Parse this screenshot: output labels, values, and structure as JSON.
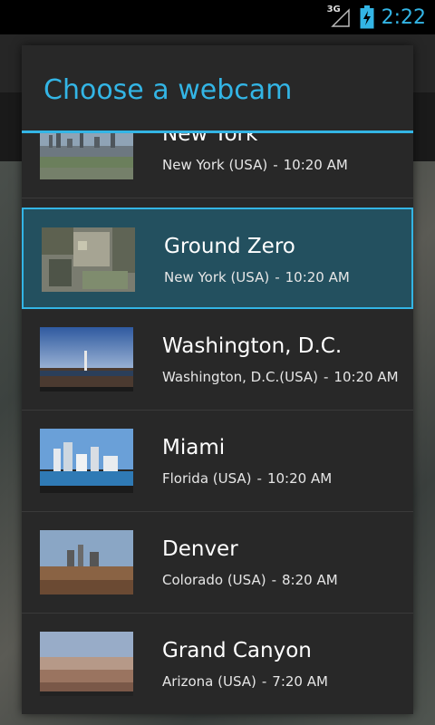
{
  "status": {
    "network": "3G",
    "time": "2:22"
  },
  "dialog": {
    "title": "Choose a webcam"
  },
  "webcams": [
    {
      "name": "New York",
      "location": "New York (USA)",
      "local_time": "10:20 AM"
    },
    {
      "name": "Ground Zero",
      "location": "New York (USA)",
      "local_time": "10:20 AM",
      "selected": true
    },
    {
      "name": "Washington, D.C.",
      "location": "Washington, D.C.(USA)",
      "local_time": "10:20 AM"
    },
    {
      "name": "Miami",
      "location": "Florida (USA)",
      "local_time": "10:20 AM"
    },
    {
      "name": "Denver",
      "location": "Colorado (USA)",
      "local_time": "8:20 AM"
    },
    {
      "name": "Grand Canyon",
      "location": "Arizona (USA)",
      "local_time": "7:20 AM"
    }
  ],
  "colors": {
    "accent": "#33b5e5",
    "dialog_bg": "#282828",
    "selected_bg": "#23505f"
  }
}
